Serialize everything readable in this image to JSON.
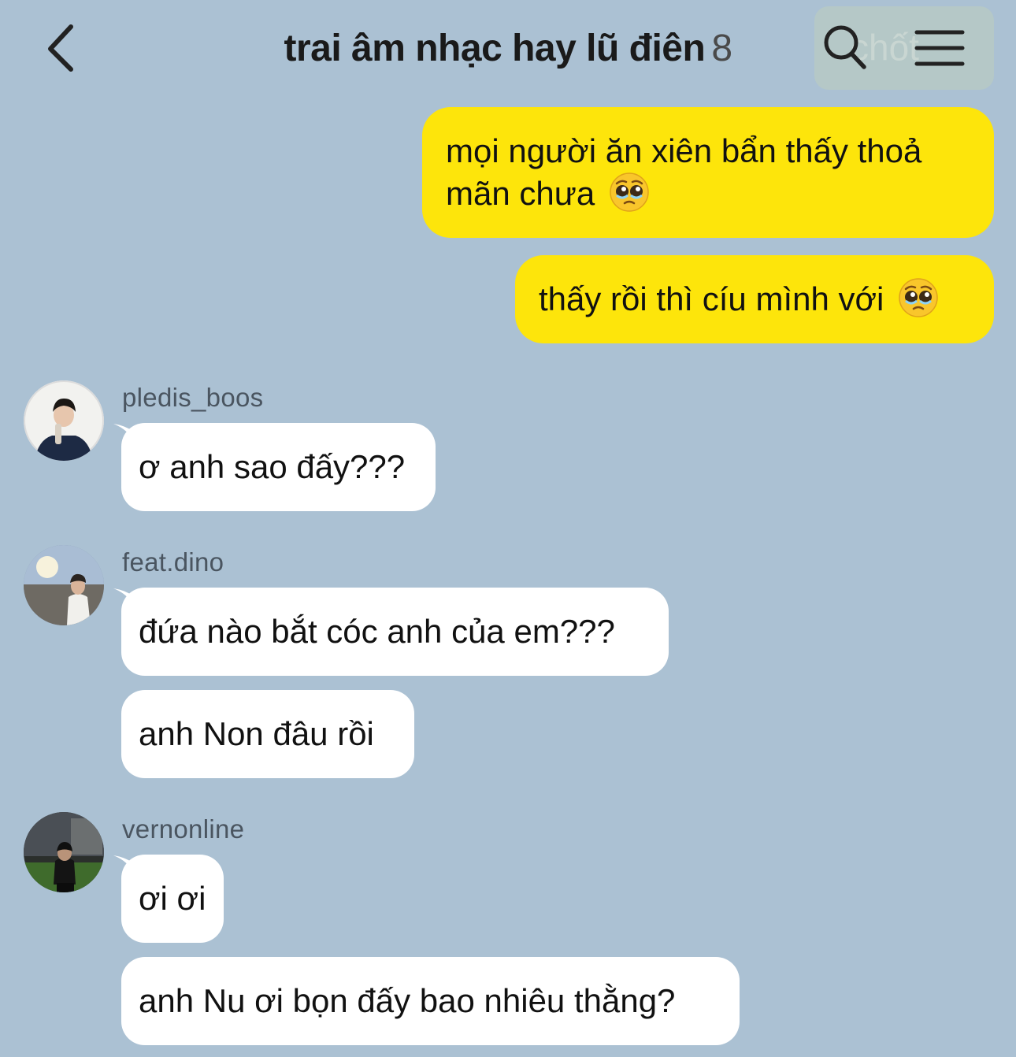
{
  "header": {
    "title": "trai âm nhạc hay lũ điên",
    "member_count": "8",
    "ghost_text": "chốt",
    "back_icon": "chevron-left-icon",
    "search_icon": "search-icon",
    "menu_icon": "menu-icon"
  },
  "colors": {
    "background": "#abc1d3",
    "outgoing_bubble": "#fde50b",
    "incoming_bubble": "#ffffff"
  },
  "outgoing": [
    {
      "line1": "mọi người ăn xiên bẩn thấy thoả",
      "line2": "mãn chưa",
      "emoji": "pleading-face"
    },
    {
      "text": "thấy rồi thì cíu mình với",
      "emoji": "pleading-face"
    }
  ],
  "groups": [
    {
      "sender": "pledis_boos",
      "messages": [
        "ơ anh sao đấy???"
      ]
    },
    {
      "sender": "feat.dino",
      "messages": [
        "đứa nào bắt cóc anh của em???",
        "anh Non đâu rồi"
      ]
    },
    {
      "sender": "vernonline",
      "messages": [
        "ơi ơi",
        "anh Nu ơi bọn đấy bao nhiêu thằng?"
      ]
    }
  ]
}
